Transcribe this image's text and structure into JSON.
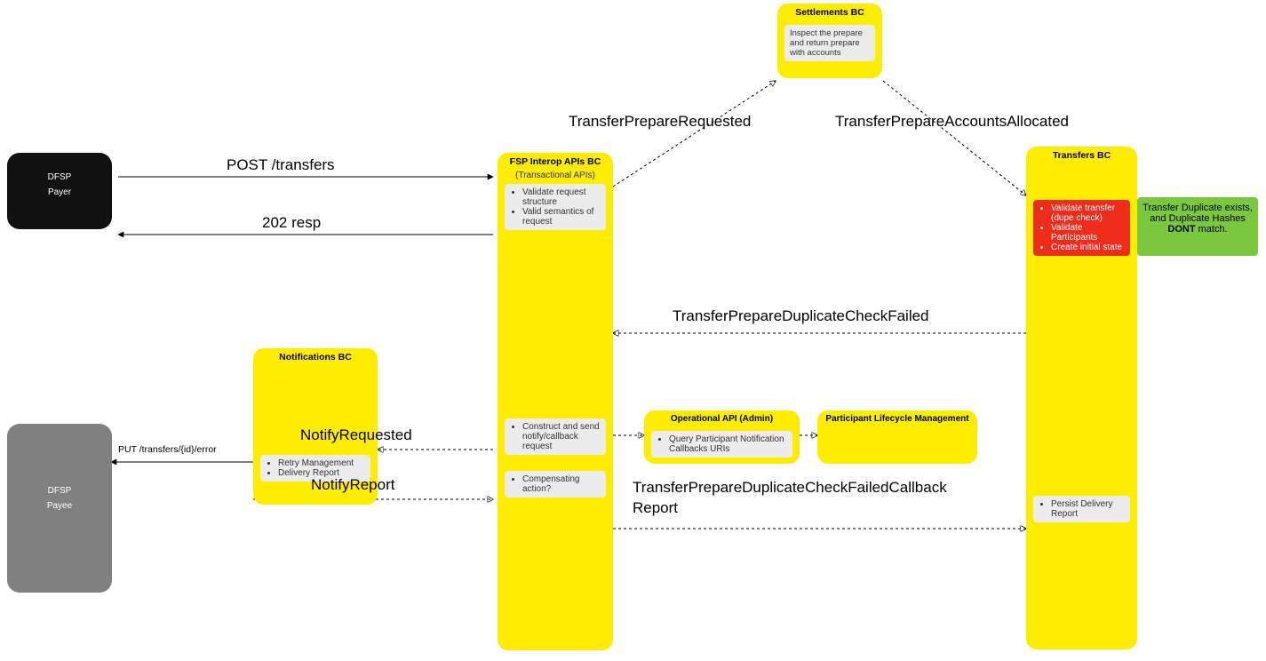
{
  "nodes": {
    "payer": {
      "l1": "DFSP",
      "l2": "Payer"
    },
    "payee": {
      "l1": "DFSP",
      "l2": "Payee"
    },
    "settlements": {
      "title": "Settlements BC",
      "bullets": [
        "Inspect the prepare and return prepare with accounts"
      ]
    },
    "fsp": {
      "title": "FSP Interop APIs BC",
      "sub": "(Transactional APIs)",
      "b1": [
        "Validate request structure",
        "Valid semantics of request"
      ],
      "b2": [
        "Construct and send notify/callback request"
      ],
      "b3": [
        "Compensating action?"
      ]
    },
    "notif": {
      "title": "Notifications BC",
      "bullets": [
        "Retry Management",
        "Delivery Report"
      ]
    },
    "opapi": {
      "title": "Operational API (Admin)",
      "bullets": [
        "Query Participant Notification Callbacks URIs"
      ]
    },
    "plm": {
      "title": "Participant Lifecycle Management"
    },
    "transfers": {
      "title": "Transfers BC",
      "red": [
        "Validate transfer (dupe check)",
        "Validate Participants",
        "Create initial state"
      ],
      "b2": [
        "Persist Delivery Report"
      ]
    },
    "note": {
      "prefix": "Transfer Duplicate exists, and Duplicate Hashes ",
      "bold": "DONT",
      "suffix": " match."
    }
  },
  "msgs": {
    "post": "POST /transfers",
    "resp": "202 resp",
    "tpReq": "TransferPrepareRequested",
    "tpAlloc": "TransferPrepareAccountsAllocated",
    "tpDup": "TransferPrepareDuplicateCheckFailed",
    "notifyReq": "NotifyRequested",
    "notifyRep": "NotifyReport",
    "put": "PUT /transfers/{id}/error",
    "cbRep1": "TransferPrepareDuplicateCheckFailedCallback",
    "cbRep2": "Report"
  }
}
